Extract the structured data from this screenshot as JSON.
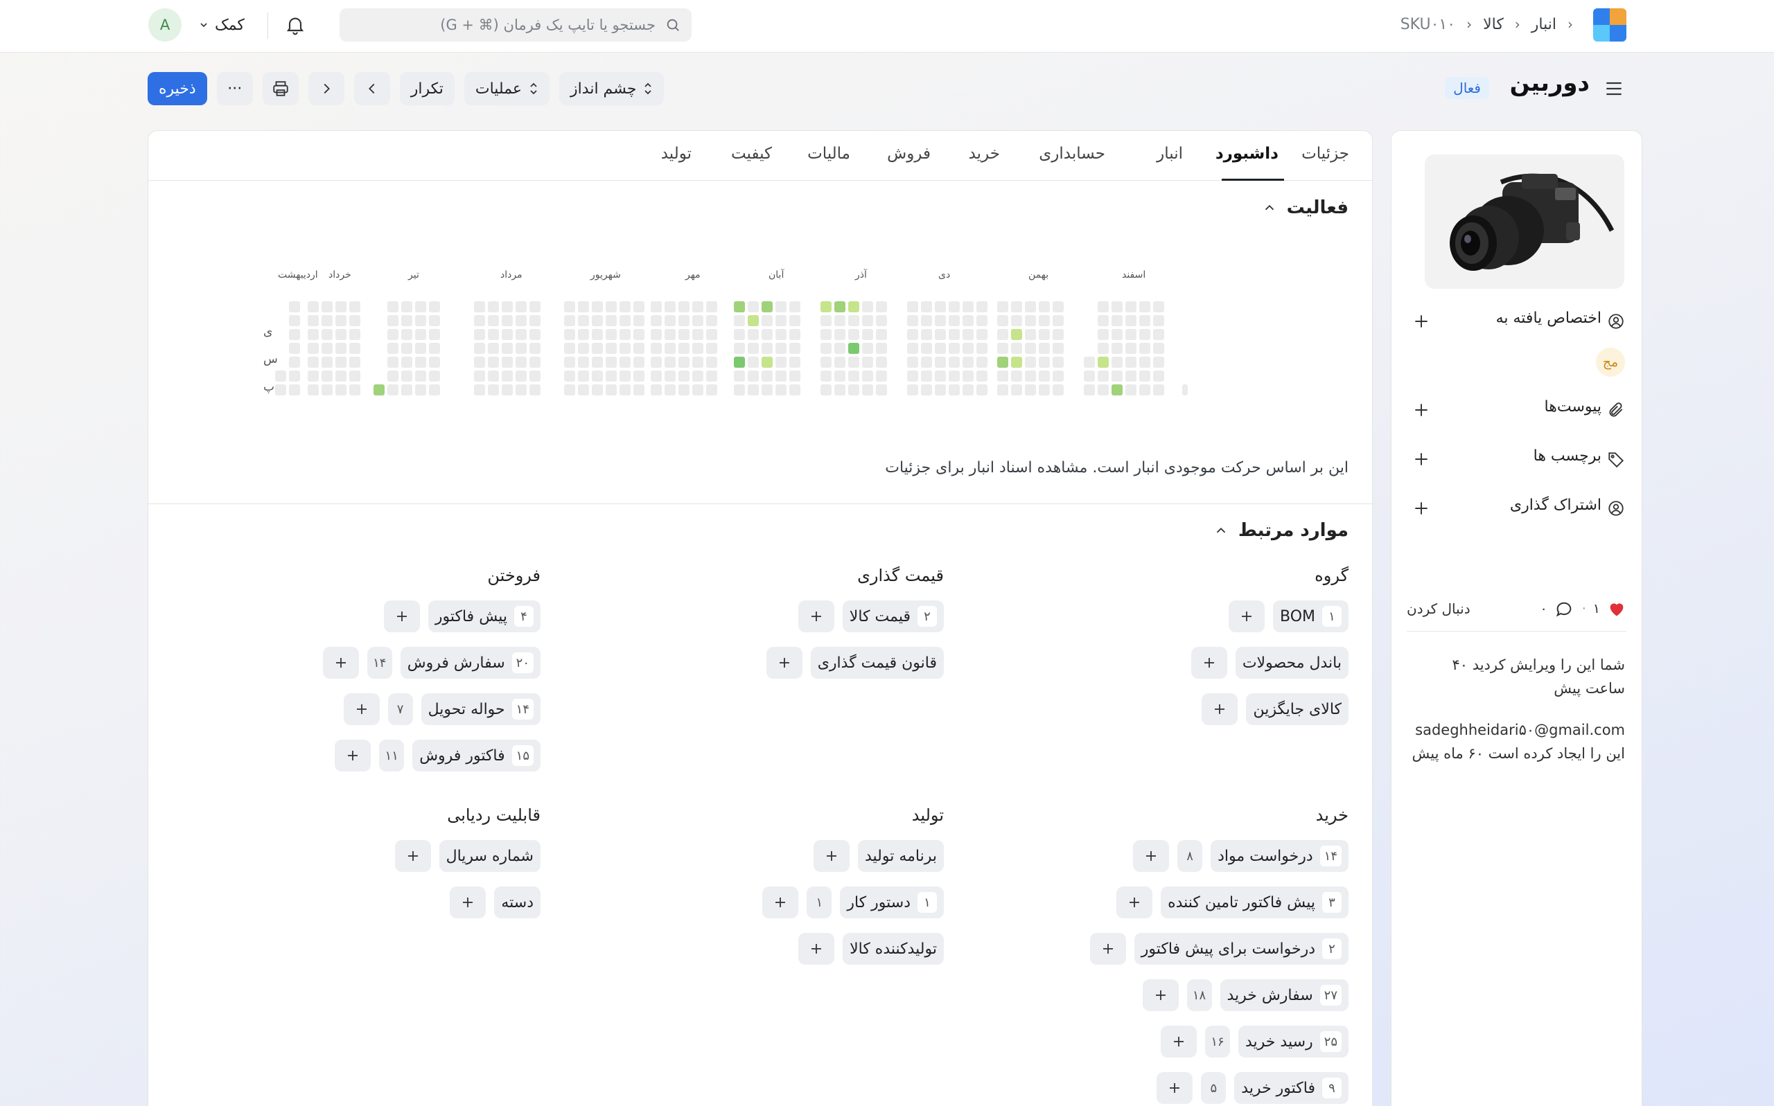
{
  "topbar": {
    "breadcrumb": [
      "انبار",
      "کالا",
      "SKU۰۱۰"
    ],
    "search_placeholder": "جستجو یا تایپ یک فرمان (⌘ + G)",
    "help_label": "کمک",
    "avatar_initial": "A"
  },
  "header": {
    "title": "دوربین",
    "status": "فعال",
    "save_label": "ذخیره",
    "more_label": "···",
    "repeat_label": "تکرار",
    "operations_label": "عملیات",
    "view_label": "چشم انداز"
  },
  "tabs": [
    {
      "label": "جزئیات",
      "active": false
    },
    {
      "label": "داشبورد",
      "active": true
    },
    {
      "label": "انبار",
      "active": false
    },
    {
      "label": "حسابداری",
      "active": false
    },
    {
      "label": "خرید",
      "active": false
    },
    {
      "label": "فروش",
      "active": false
    },
    {
      "label": "مالیات",
      "active": false
    },
    {
      "label": "کیفیت",
      "active": false
    },
    {
      "label": "تولید",
      "active": false
    }
  ],
  "activity": {
    "title": "فعالیت",
    "months": [
      "اسفند",
      "بهمن",
      "دی",
      "آذر",
      "آبان",
      "مهر",
      "شهریور",
      "مرداد",
      "تیر",
      "خرداد",
      "اردیبهشت"
    ],
    "days": [
      "ی",
      "س",
      "پ"
    ],
    "note": "این بر اساس حرکت موجودی انبار است. مشاهده اسناد انبار برای جزئیات",
    "colors": {
      "empty": "#ebebeb",
      "low": "#c6e48b",
      "mid": "#9fd27a",
      "high": "#7bc96f"
    }
  },
  "related": {
    "title": "موارد مرتبط",
    "groups": [
      {
        "title": "گروه",
        "items": [
          {
            "label": "BOM",
            "count": "۱",
            "extra": ""
          },
          {
            "label": "باندل محصولات",
            "count": "",
            "extra": ""
          },
          {
            "label": "کالای جایگزین",
            "count": "",
            "extra": ""
          }
        ]
      },
      {
        "title": "قیمت گذاری",
        "items": [
          {
            "label": "قیمت کالا",
            "count": "۲",
            "extra": ""
          },
          {
            "label": "قانون قیمت گذاری",
            "count": "",
            "extra": ""
          }
        ]
      },
      {
        "title": "فروختن",
        "items": [
          {
            "label": "پیش فاکتور",
            "count": "۴",
            "extra": ""
          },
          {
            "label": "سفارش فروش",
            "count": "۲۰",
            "extra": "۱۴"
          },
          {
            "label": "حواله تحویل",
            "count": "۱۴",
            "extra": "۷"
          },
          {
            "label": "فاکتور فروش",
            "count": "۱۵",
            "extra": "۱۱"
          }
        ]
      },
      {
        "title": "خرید",
        "items": [
          {
            "label": "درخواست مواد",
            "count": "۱۴",
            "extra": "۸"
          },
          {
            "label": "پیش فاکتور تامین کننده",
            "count": "۳",
            "extra": ""
          },
          {
            "label": "درخواست برای پیش فاکتور",
            "count": "۲",
            "extra": ""
          },
          {
            "label": "سفارش خرید",
            "count": "۲۷",
            "extra": "۱۸"
          },
          {
            "label": "رسید خرید",
            "count": "۲۵",
            "extra": "۱۶"
          },
          {
            "label": "فاکتور خرید",
            "count": "۹",
            "extra": "۵"
          }
        ]
      },
      {
        "title": "تولید",
        "items": [
          {
            "label": "برنامه تولید",
            "count": "",
            "extra": ""
          },
          {
            "label": "دستور کار",
            "count": "۱",
            "extra": "۱"
          },
          {
            "label": "تولیدکننده کالا",
            "count": "",
            "extra": ""
          }
        ]
      },
      {
        "title": "قابلیت ردیابی",
        "items": [
          {
            "label": "شماره سریال",
            "count": "",
            "extra": ""
          },
          {
            "label": "دسته",
            "count": "",
            "extra": ""
          }
        ]
      }
    ]
  },
  "sidebar": {
    "assigned_label": "اختصاص یافته به",
    "assignee_initials": "مج",
    "attachments_label": "پیوست‌ها",
    "tags_label": "برچسب ها",
    "share_label": "اشتراک گذاری",
    "likes": "۱",
    "dot": "·",
    "comments": "۰",
    "follow_label": "دنبال کردن",
    "edit_activity": "شما این را ویرایش کردید ۴۰ ساعت پیش",
    "creator_email": "sadeghheidari۵۰@gmail.com",
    "create_activity": "این را ایجاد کرده است ۶۰ ماه پیش"
  }
}
